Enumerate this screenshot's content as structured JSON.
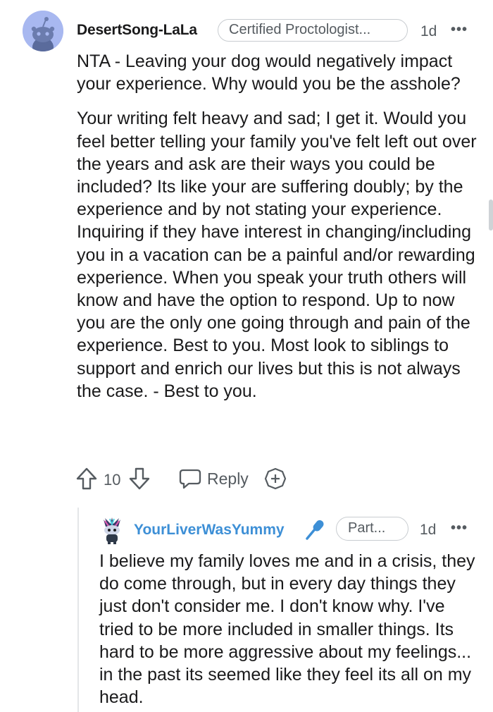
{
  "comment": {
    "username": "DesertSong-LaLa",
    "flair": "Certified Proctologist...",
    "time": "1d",
    "more": "•••",
    "paragraphs": [
      "NTA - Leaving your dog would negatively impact your experience. Why would you be the asshole?",
      "Your writing felt heavy and sad; I get it. Would you feel better telling your family you've felt left out over the years and ask are their ways you could be included? Its like your are suffering doubly; by the experience and by not stating your experience. Inquiring if they have interest in changing/including you in a vacation can be a painful and/or rewarding experience. When you speak your truth others will know and have the option to respond. Up to now you are the only one going through and pain of the experience. Best to you. Most look to siblings to support and enrich our lives but this is not always the case. - Best to you."
    ],
    "votes": "10",
    "reply_label": "Reply"
  },
  "reply": {
    "username": "YourLiverWasYummy",
    "flair": "Part...",
    "time": "1d",
    "more": "•••",
    "text": "I believe my family loves me and in a crisis, they do come through, but in every day things they just don't consider me. I don't know why. I've tried to be more included in smaller things. Its hard to be more aggressive about my feelings... in the past its seemed like they feel its all on my head."
  },
  "colors": {
    "username_reply": "#3d8fd6",
    "avatar_bg": "#a8b8f0",
    "muted_text": "#555b60"
  }
}
